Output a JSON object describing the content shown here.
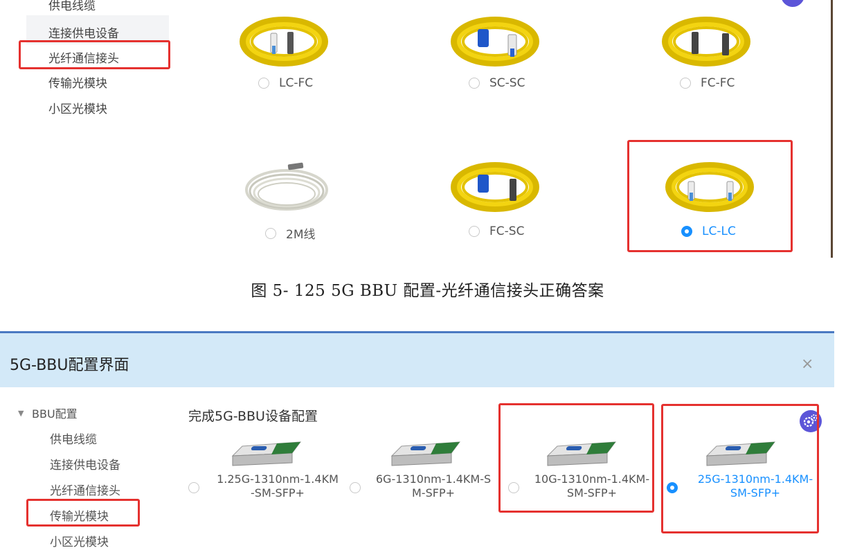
{
  "top_sidebar": {
    "items": [
      "供电线缆",
      "连接供电设备",
      "光纤通信接头",
      "传输光模块",
      "小区光模块"
    ],
    "highlighted_index": 2
  },
  "connector_options": [
    {
      "label": "LC-FC",
      "selected": false,
      "cable_color": "yellow"
    },
    {
      "label": "SC-SC",
      "selected": false,
      "cable_color": "yellow"
    },
    {
      "label": "FC-FC",
      "selected": false,
      "cable_color": "yellow"
    },
    {
      "label": "2M线",
      "selected": false,
      "cable_color": "white"
    },
    {
      "label": "FC-SC",
      "selected": false,
      "cable_color": "yellow"
    },
    {
      "label": "LC-LC",
      "selected": true,
      "cable_color": "yellow"
    }
  ],
  "caption": "图 5- 125 5G BBU 配置-光纤通信接头正确答案",
  "dialog": {
    "title": "5G-BBU配置界面",
    "close_symbol": "×",
    "tree_caret": "▼",
    "tree_root": "BBU配置",
    "tree_items": [
      "供电线缆",
      "连接供电设备",
      "光纤通信接头",
      "传输光模块",
      "小区光模块"
    ],
    "highlighted_index": 3,
    "content_title": "完成5G-BBU设备配置",
    "modules": [
      {
        "line1": "1.25G-1310nm-1.4KM",
        "line2": "-SM-SFP+",
        "selected": false
      },
      {
        "line1": "6G-1310nm-1.4KM-S",
        "line2": "M-SFP+",
        "selected": false
      },
      {
        "line1": "10G-1310nm-1.4KM-",
        "line2": "SM-SFP+",
        "selected": false
      },
      {
        "line1": "25G-1310nm-1.4KM-",
        "line2": "SM-SFP+",
        "selected": true
      }
    ]
  },
  "colors": {
    "highlight_red": "#e5312f",
    "selected_blue": "#1890ff",
    "dialog_header": "#d3e9f8",
    "cable_yellow": "#f0d000",
    "gear_purple": "#5c55d8"
  },
  "icons": [
    "settings-gear-icon",
    "close-icon",
    "caret-down-icon"
  ]
}
